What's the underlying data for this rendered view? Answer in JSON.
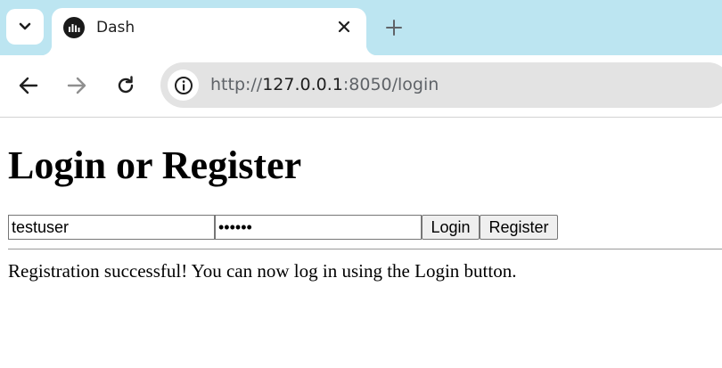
{
  "browser": {
    "tab": {
      "title": "Dash",
      "favicon": "dash-logo-icon"
    },
    "toolbar": {
      "back_icon": "back-arrow-icon",
      "forward_icon": "forward-arrow-icon",
      "reload_icon": "reload-icon",
      "site_info_icon": "info-icon"
    },
    "url": {
      "scheme": "http://",
      "host": "127.0.0.1",
      "rest": ":8050/login"
    }
  },
  "page": {
    "heading": "Login or Register",
    "form": {
      "username_value": "testuser",
      "password_value": "abcdef",
      "login_label": "Login",
      "register_label": "Register"
    },
    "message": "Registration successful! You can now log in using the Login button."
  },
  "colors": {
    "tabstrip_bg": "#bce5f1",
    "omnibox_bg": "#e3e3e3",
    "button_bg": "#efefef"
  }
}
